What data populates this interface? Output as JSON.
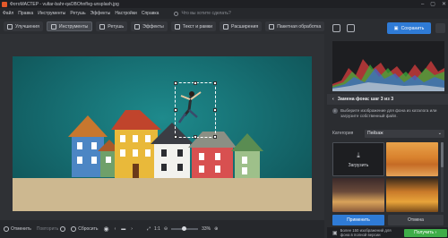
{
  "window": {
    "title": "ФотоМАСТЕР - vultar-bahr-qaOBOhnflvg-unsplash.jpg",
    "min_icon": "minimize-icon",
    "max_icon": "maximize-icon",
    "close_icon": "close-icon"
  },
  "menu": {
    "items": [
      "Файл",
      "Правка",
      "Инструменты",
      "Ретушь",
      "Эффекты",
      "Настройки",
      "Справка"
    ],
    "search_placeholder": "Что вы хотите сделать?"
  },
  "toolbar": {
    "items": [
      {
        "label": "Улучшения",
        "icon": "sliders-icon"
      },
      {
        "label": "Инструменты",
        "icon": "crop-icon",
        "active": true
      },
      {
        "label": "Ретушь",
        "icon": "brush-icon"
      },
      {
        "label": "Эффекты",
        "icon": "effects-icon"
      },
      {
        "label": "Текст и рамки",
        "icon": "text-icon"
      },
      {
        "label": "Расширения",
        "icon": "plus-icon"
      },
      {
        "label": "Пакетная обработка",
        "icon": "batch-icon"
      }
    ]
  },
  "right_panel": {
    "save_label": "Сохранить",
    "step_title": "Замена фона: шаг 3 из 3",
    "info_text": "Выберите изображение для фона из каталога или загрузите собственный файл.",
    "category_label": "Категория",
    "category_value": "Пейзаж",
    "upload_label": "Загрузить",
    "apply_label": "Применить",
    "cancel_label": "Отмена",
    "promo_text": "Более 150 изображений для фона в полной версии",
    "buy_label": "Получить"
  },
  "bottom_bar": {
    "undo_label": "Отменить",
    "redo_label": "Повторить",
    "reset_label": "Сбросить",
    "ratio_label": "1:1",
    "zoom_value": "33%"
  }
}
